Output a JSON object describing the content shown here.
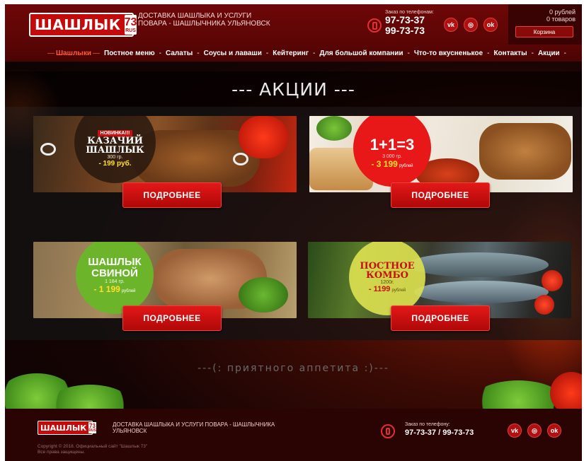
{
  "header": {
    "logo_text": "ШАШЛЫК",
    "logo_number": "73",
    "logo_suffix": "RUS",
    "tagline": "ДОСТАВКА ШАШЛЫКА И УСЛУГИ ПОВАРА - ШАШЛЫЧНИКА УЛЬЯНОВСК",
    "phone_label": "Заказ по телефонам:",
    "phone1": "97-73-37",
    "phone2": "99-73-73",
    "social": [
      {
        "name": "vk-icon",
        "glyph": "vk"
      },
      {
        "name": "instagram-icon",
        "glyph": "◎"
      },
      {
        "name": "odnoklassniki-icon",
        "glyph": "ok"
      }
    ]
  },
  "cart": {
    "total": "0 рублей",
    "count": "0 товаров",
    "button": "Корзина"
  },
  "nav": {
    "items": [
      "Шашлыки",
      "Постное меню",
      "Салаты",
      "Соусы и лаваши",
      "Кейтеринг",
      "Для большой компании",
      "Что-то вкусненькое",
      "Контакты",
      "Акции"
    ],
    "active_index": 0
  },
  "page_title": "--- АКЦИИ ---",
  "promos": [
    {
      "badge_top": "НОВИНКА!!!",
      "badge_title": "КАЗАЧИЙ ШАШЛЫК",
      "badge_weight": "300 гр.",
      "badge_price": "- 199 руб.",
      "button": "ПОДРОБНЕЕ"
    },
    {
      "badge_title": "1+1=3",
      "badge_old": "3 000 гр.",
      "badge_price": "- 3 199",
      "badge_currency": "рублей",
      "button": "ПОДРОБНЕЕ"
    },
    {
      "badge_title": "ШАШЛЫК СВИНОЙ",
      "badge_weight": "1 184 гр.",
      "badge_price": "- 1 199",
      "badge_currency": "рублей",
      "button": "ПОДРОБНЕЕ"
    },
    {
      "badge_title": "ПОСТНОЕ КОМБО",
      "badge_weight": "1200г.",
      "badge_price": "- 1199",
      "badge_currency": "рублей",
      "button": "ПОДРОБНЕЕ"
    }
  ],
  "appetite": "---(:  приятного аппетита  :)---",
  "footer": {
    "logo_text": "ШАШЛЫК",
    "logo_number": "73",
    "logo_suffix": "RUS",
    "tagline": "ДОСТАВКА ШАШЛЫКА И УСЛУГИ ПОВАРА - ШАШЛЫЧНИКА УЛЬЯНОВСК",
    "copyright": "Copyright © 2018. Официальный сайт \"Шашлык 73\"",
    "rights": "Все права защищены.",
    "phone_label": "Заказ по телефону:",
    "phones": "97-73-37  /  99-73-73"
  },
  "colors": {
    "brand_red": "#c30b0b",
    "header_bg": "#6e0707",
    "nav_active": "#ff5a3a",
    "button_red": "#e31818"
  }
}
